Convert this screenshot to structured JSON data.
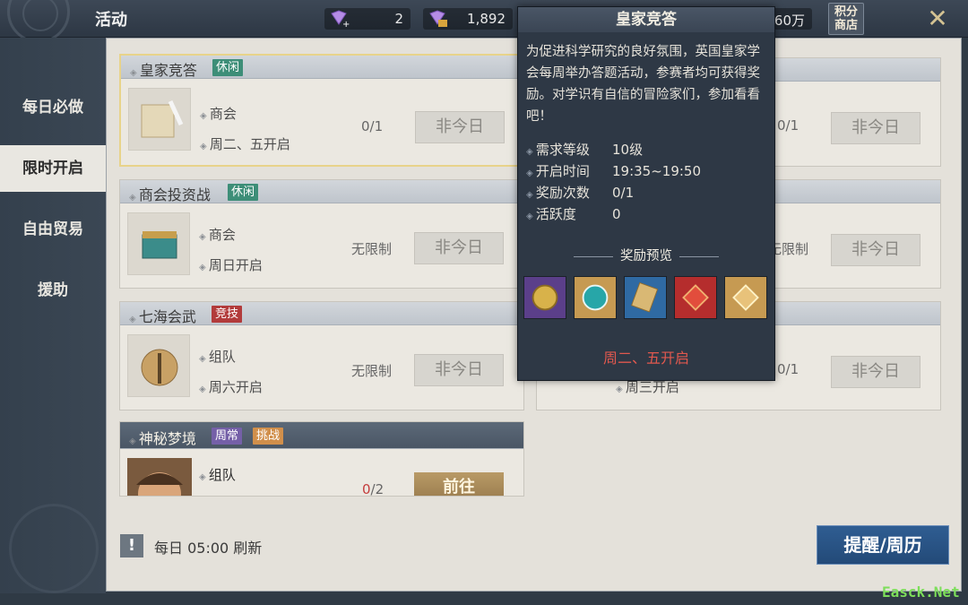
{
  "header": {
    "title": "活动",
    "currencies": [
      {
        "icon": "purple-gem-plus-icon",
        "value": "2"
      },
      {
        "icon": "purple-gem-bound-icon",
        "value": "1,892"
      },
      {
        "icon": "coin-icon",
        "value": "60万"
      }
    ],
    "shop_label": "积分\n商店",
    "close_icon": "close-x-icon"
  },
  "sidebar": {
    "items": [
      {
        "label": "每日必做",
        "active": false
      },
      {
        "label": "限时开启",
        "active": true
      },
      {
        "label": "自由贸易",
        "active": false
      },
      {
        "label": "援助",
        "active": false
      }
    ]
  },
  "cards": [
    {
      "title": "皇家竞答",
      "tags": [
        {
          "label": "休闲",
          "color": "green"
        }
      ],
      "lines": [
        "商会",
        "周二、五开启"
      ],
      "count": "0/1",
      "button": "非今日",
      "selected": true
    },
    {
      "title": "商会投资战",
      "tags": [
        {
          "label": "休闲",
          "color": "green"
        }
      ],
      "lines": [
        "商会",
        "周日开启"
      ],
      "count": "无限制",
      "button": "非今日"
    },
    {
      "title": "七海会武",
      "tags": [
        {
          "label": "竞技",
          "color": "red"
        }
      ],
      "lines": [
        "组队",
        "周六开启"
      ],
      "count": "无限制",
      "button": "非今日"
    },
    {
      "title": "神秘梦境",
      "tags": [
        {
          "label": "周常",
          "color": "purple"
        },
        {
          "label": "挑战",
          "color": "orange"
        }
      ],
      "lines": [
        "组队"
      ],
      "count_red": "0",
      "count_rest": "/2",
      "button": "前往"
    }
  ],
  "right_cards": [
    {
      "count": "0/1",
      "button": "非今日"
    },
    {
      "count": "无限制",
      "button": "非今日"
    },
    {
      "count": "0/1",
      "button": "非今日",
      "line": "周三开启"
    }
  ],
  "tooltip": {
    "title": "皇家竞答",
    "description": "为促进科学研究的良好氛围，英国皇家学会每周举办答题活动，参赛者均可获得奖励。对学识有自信的冒险家们，参加看看吧！",
    "rows": [
      {
        "key": "需求等级",
        "value": "10级"
      },
      {
        "key": "开启时间",
        "value": "19:35~19:50"
      },
      {
        "key": "奖励次数",
        "value": "0/1"
      },
      {
        "key": "活跃度",
        "value": "0"
      }
    ],
    "reward_title": "奖励预览",
    "rewards": [
      {
        "icon": "gold-coin-reward-icon",
        "bg": "#5b3f8a"
      },
      {
        "icon": "teal-gem-reward-icon",
        "bg": "#c69a52"
      },
      {
        "icon": "scroll-reward-icon",
        "bg": "#2f6aa3"
      },
      {
        "icon": "red-puzzle-reward-icon",
        "bg": "#b52d2d"
      },
      {
        "icon": "gold-puzzle-reward-icon",
        "bg": "#c69a52"
      }
    ],
    "footer": "周二、五开启"
  },
  "footer": {
    "warning_icon": "!",
    "refresh_text": "每日 05:00 刷新",
    "remind_button": "提醒/周历"
  },
  "watermark": "Easck.Net"
}
